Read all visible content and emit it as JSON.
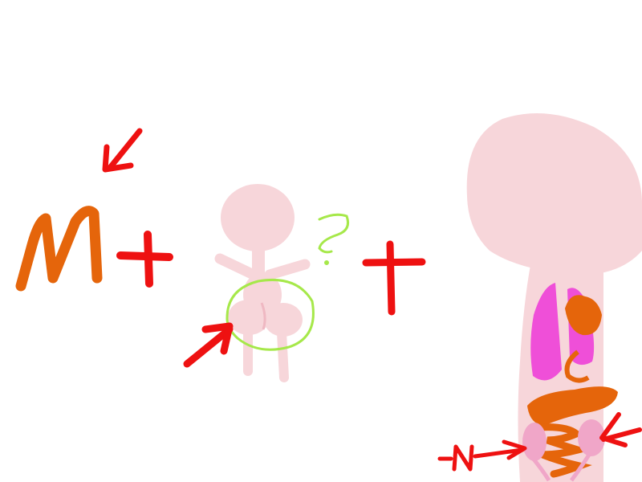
{
  "drawing": {
    "colors": {
      "background": "#ffffff",
      "skin": "#f7d6da",
      "skin_shadow": "#efb8c2",
      "letter": "#e5650b",
      "marker": "#ee1111",
      "highlight": "#a6e84a",
      "lung": "#ef4fd8",
      "organ_orange": "#e5650b",
      "kidney": "#f0a6c8"
    },
    "marks": {
      "letter_m": "M",
      "question": "?",
      "letter_n": "N"
    }
  }
}
